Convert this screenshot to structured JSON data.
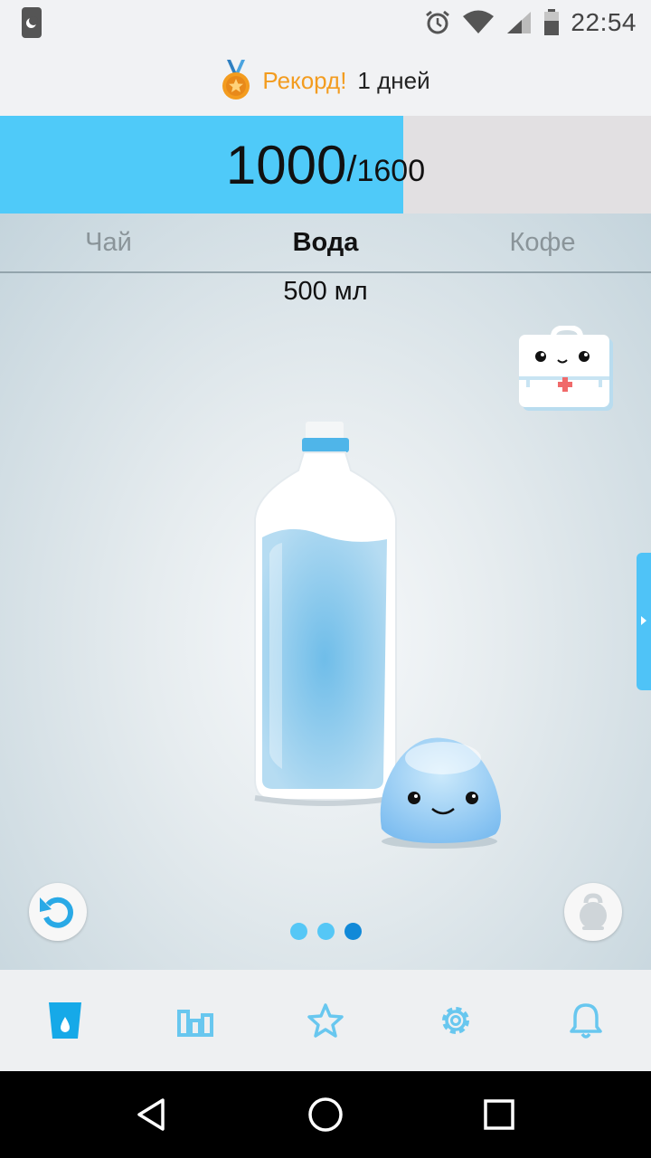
{
  "status_bar": {
    "time": "22:54",
    "icons": [
      "night-mode-icon",
      "alarm-icon",
      "wifi-icon",
      "cell-signal-icon",
      "battery-icon"
    ]
  },
  "record": {
    "label": "Рекорд!",
    "value": "1 дней",
    "icon": "medal-icon"
  },
  "progress": {
    "current": "1000",
    "separator": "/",
    "goal": "1600",
    "fill_fraction": 0.62,
    "fill_color": "#4fcaf9"
  },
  "tabs": [
    {
      "label": "Чай",
      "active": false
    },
    {
      "label": "Вода",
      "active": true
    },
    {
      "label": "Кофе",
      "active": false
    }
  ],
  "amount": "500 мл",
  "illustration": {
    "bottle_fill_color": "#9fd2ee",
    "icons": [
      "first-aid-kit-icon",
      "water-bottle-icon",
      "water-drop-character-icon"
    ]
  },
  "pager": {
    "count": 3,
    "active_index": 2
  },
  "bottom_nav": [
    {
      "name": "nav-drink",
      "icon": "water-glass-icon",
      "active": true
    },
    {
      "name": "nav-stats",
      "icon": "bar-chart-icon",
      "active": false
    },
    {
      "name": "nav-achievements",
      "icon": "star-icon",
      "active": false
    },
    {
      "name": "nav-settings",
      "icon": "gear-icon",
      "active": false
    },
    {
      "name": "nav-reminders",
      "icon": "bell-icon",
      "active": false
    }
  ],
  "colors": {
    "accent": "#4fcaf9",
    "record_label": "#f39c1f",
    "nav_active": "#16a9e8",
    "nav_inactive": "#68c7ef"
  }
}
